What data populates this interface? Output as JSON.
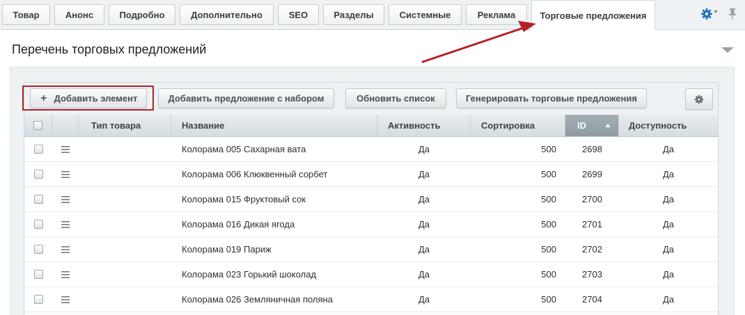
{
  "tabs": [
    {
      "label": "Товар"
    },
    {
      "label": "Анонс"
    },
    {
      "label": "Подробно"
    },
    {
      "label": "Дополнительно"
    },
    {
      "label": "SEO"
    },
    {
      "label": "Разделы"
    },
    {
      "label": "Системные"
    },
    {
      "label": "Реклама"
    },
    {
      "label": "Торговые предложения",
      "active": true
    }
  ],
  "tab_tools": {
    "settings_icon": "gear-icon",
    "pin_icon": "pin-icon"
  },
  "section": {
    "title": "Перечень торговых предложений"
  },
  "toolbar": {
    "add_element_label": "Добавить элемент",
    "add_with_set_label": "Добавить предложение с набором",
    "refresh_label": "Обновить список",
    "generate_label": "Генерировать торговые предложения"
  },
  "columns": {
    "type": "Тип товара",
    "name": "Название",
    "active": "Активность",
    "sort": "Сортировка",
    "id": "ID",
    "availability": "Доступность"
  },
  "rows": [
    {
      "name": "Колорама 005 Сахарная вата",
      "active": "Да",
      "sort": "500",
      "id": "2698",
      "availability": "Да"
    },
    {
      "name": "Колорама 006 Клюквенный сорбет",
      "active": "Да",
      "sort": "500",
      "id": "2699",
      "availability": "Да"
    },
    {
      "name": "Колорама 015 Фруктовый сок",
      "active": "Да",
      "sort": "500",
      "id": "2700",
      "availability": "Да"
    },
    {
      "name": "Колорама 016 Дикая ягода",
      "active": "Да",
      "sort": "500",
      "id": "2701",
      "availability": "Да"
    },
    {
      "name": "Колорама 019 Париж",
      "active": "Да",
      "sort": "500",
      "id": "2702",
      "availability": "Да"
    },
    {
      "name": "Колорама 023 Горький шоколад",
      "active": "Да",
      "sort": "500",
      "id": "2703",
      "availability": "Да"
    },
    {
      "name": "Колорама 026 Земляничная поляна",
      "active": "Да",
      "sort": "500",
      "id": "2704",
      "availability": "Да"
    }
  ],
  "colors": {
    "annotation": "#b32026",
    "accent": "#1e6fb8",
    "sorted_header": "#95a3aa"
  }
}
